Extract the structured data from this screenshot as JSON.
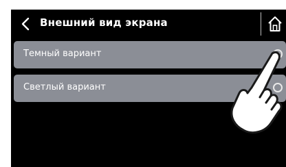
{
  "header": {
    "title": "Внешний вид экрана",
    "back_icon": "chevron-left-icon",
    "home_icon": "home-icon"
  },
  "options": [
    {
      "label": "Темный вариант",
      "selected": true
    },
    {
      "label": "Светлый вариант",
      "selected": false
    }
  ],
  "colors": {
    "screen_background": "#000000",
    "option_background": "#8b8e96",
    "text": "#ffffff"
  },
  "overlay": {
    "icon": "pointing-hand-icon"
  }
}
